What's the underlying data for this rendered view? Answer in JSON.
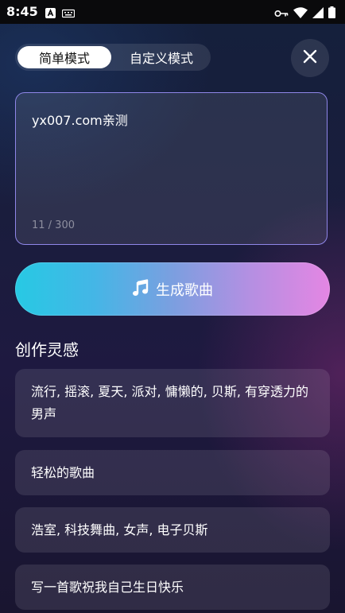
{
  "status_bar": {
    "time": "8:45",
    "left_icons": [
      "app-a-icon",
      "keyboard-icon"
    ],
    "right_icons": [
      "vpn-key-icon",
      "wifi-icon",
      "signal-icon",
      "battery-icon"
    ]
  },
  "mode_switch": {
    "simple_label": "简单模式",
    "custom_label": "自定义模式",
    "selected": "简单模式"
  },
  "prompt": {
    "value": "yx007.com亲测",
    "counter": "11 / 300"
  },
  "generate_button": {
    "label": "生成歌曲",
    "icon": "music-note-icon"
  },
  "inspiration": {
    "title": "创作灵感",
    "items": [
      "流行, 摇滚, 夏天, 派对, 慵懒的, 贝斯, 有穿透力的男声",
      "轻松的歌曲",
      "浩室, 科技舞曲, 女声, 电子贝斯",
      "写一首歌祝我自己生日快乐"
    ]
  },
  "colors": {
    "accent_border": "#8f86e8",
    "gradient_start": "#27c9e4",
    "gradient_end": "#e486e3"
  }
}
